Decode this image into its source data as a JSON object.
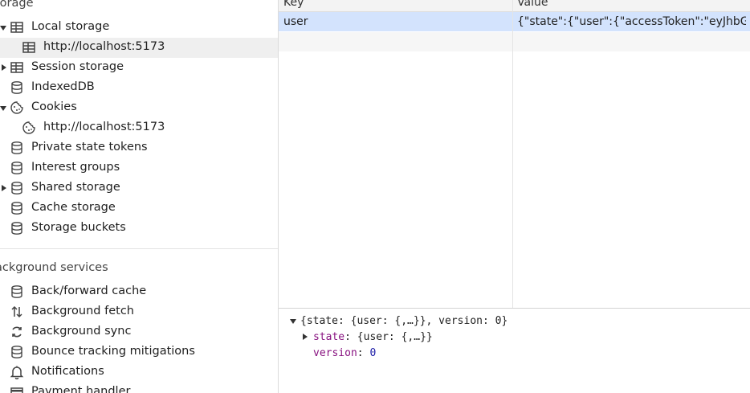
{
  "sidebar": {
    "storage_header": "torage",
    "items": [
      {
        "label": "Local storage"
      },
      {
        "label": "http://localhost:5173"
      },
      {
        "label": "Session storage"
      },
      {
        "label": "IndexedDB"
      },
      {
        "label": "Cookies"
      },
      {
        "label": "http://localhost:5173"
      },
      {
        "label": "Private state tokens"
      },
      {
        "label": "Interest groups"
      },
      {
        "label": "Shared storage"
      },
      {
        "label": "Cache storage"
      },
      {
        "label": "Storage buckets"
      }
    ],
    "background_header": "ackground services",
    "bg_items": [
      {
        "label": "Back/forward cache"
      },
      {
        "label": "Background fetch"
      },
      {
        "label": "Background sync"
      },
      {
        "label": "Bounce tracking mitigations"
      },
      {
        "label": "Notifications"
      },
      {
        "label": "Payment handler"
      }
    ]
  },
  "table": {
    "col_key": "Key",
    "col_value": "Value",
    "rows": [
      {
        "key": "user",
        "value": "{\"state\":{\"user\":{\"accessToken\":\"eyJhbGc..."
      }
    ]
  },
  "preview": {
    "root": "{state: {user: {,…}}, version: 0}",
    "state_key": "state",
    "state_val": "{user: {,…}}",
    "version_key": "version",
    "version_val": "0"
  }
}
